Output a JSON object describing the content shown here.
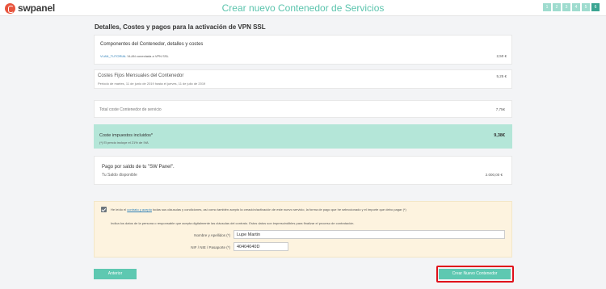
{
  "brand": {
    "logo_text": "swpanel"
  },
  "header": {
    "title": "Crear nuevo Contenedor de Servicios"
  },
  "steps": [
    "1",
    "2",
    "3",
    "4",
    "5",
    "6"
  ],
  "page": {
    "heading": "Detalles, Costes y pagos para la activación de VPN SSL"
  },
  "components": {
    "title": "Componentes del Contenedor, detalles y costes",
    "item_link": "VLAN_TUTORIAL",
    "item_desc": "VLAN conectada a VPN SSL",
    "amount": "2,50 €"
  },
  "fixed_costs": {
    "title": "Costes Fijos Mensuales del Contenedor",
    "period": "Periodo de martes, 11 de junio de 2019 hasta el jueves, 11 de julio de 2019",
    "amount": "5,25 €"
  },
  "total": {
    "label": "Total coste Contenedor de servicio",
    "amount": "7,75€"
  },
  "taxes": {
    "label": "Coste impuestos incluidos*",
    "note": "(*) El precio incluye el 21% de IVA",
    "amount": "9,38€"
  },
  "balance": {
    "title": "Pago por saldo de tu \"SW Panel\".",
    "label": "Tu Saldo disponible",
    "amount": "2.000,00 €"
  },
  "legal": {
    "accept_prefix": "He leído el",
    "accept_link": "contrato y acepto",
    "accept_suffix": "todas sus cláusulas y condiciones, así como también acepto la creación/activación de este nuevo servicio, la forma de pago que he seleccionado y el importe que debo pagar   (*)",
    "instructions": "Indica los datos de la persona o responsable que acepta digitalmente las cláusulas del contrato. Estos datos son imprescindibles para finalizar el proceso de contratación.",
    "name_label": "Nombre y Apellidos (*)",
    "name_value": "Lupe Martin",
    "id_label": "NIF / NIE / Pasaporte (*)",
    "id_value": "40404040D",
    "checked": true
  },
  "actions": {
    "prev_label": "Anterior",
    "next_label": "Crear Nuevo Contenedor"
  },
  "colors": {
    "accent": "#5ec8b1",
    "highlight": "#e0101a",
    "tax_bg": "#b4e6d8",
    "legal_bg": "#fdf3df"
  }
}
